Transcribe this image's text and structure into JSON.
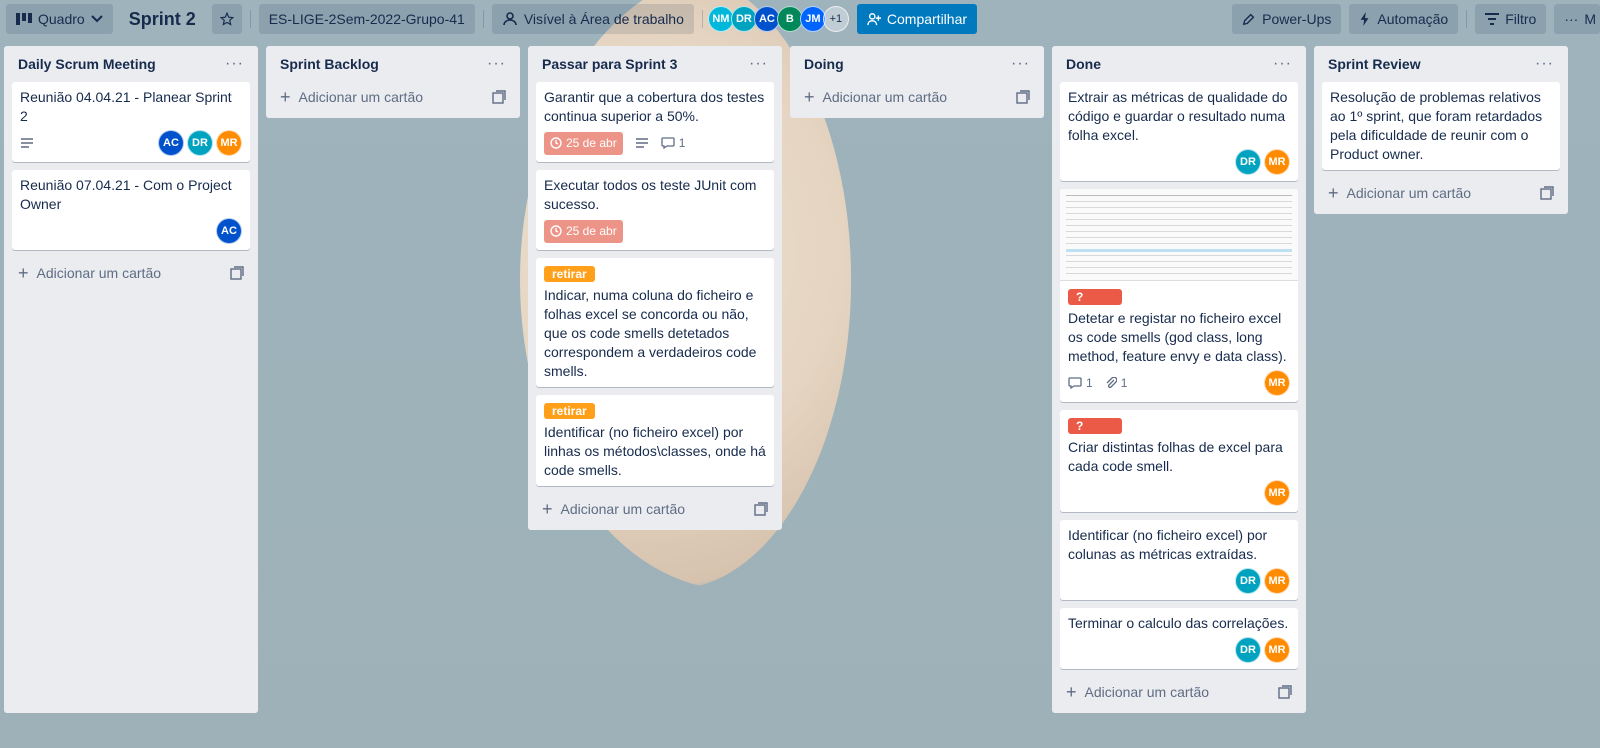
{
  "header": {
    "view_label": "Quadro",
    "board_title": "Sprint 2",
    "workspace": "ES-LIGE-2Sem-2022-Grupo-41",
    "visibility": "Visível à Área de trabalho",
    "members": [
      "NM",
      "DR",
      "AC",
      "B",
      "JM"
    ],
    "members_more": "+1",
    "share_label": "Compartilhar",
    "powerups_label": "Power-Ups",
    "automation_label": "Automação",
    "filter_label": "Filtro",
    "more_label": "M"
  },
  "add_card_label": "Adicionar um cartão",
  "lists": [
    {
      "title": "Daily Scrum Meeting",
      "cards": [
        {
          "text": "Reunião 04.04.21 - Planear Sprint 2",
          "members": [
            "AC",
            "DR",
            "MR"
          ]
        },
        {
          "text": "Reunião 07.04.21 - Com o Project Owner",
          "members": [
            "AC"
          ]
        }
      ]
    },
    {
      "title": "Sprint Backlog",
      "cards": []
    },
    {
      "title": "Passar para Sprint 3",
      "cards": [
        {
          "text": "Garantir que a cobertura dos testes continua superior a 50%.",
          "due": "25 de abr",
          "comments": "1"
        },
        {
          "text": "Executar todos os teste JUnit com sucesso.",
          "due": "25 de abr"
        },
        {
          "label": "retirar",
          "text": "Indicar, numa coluna do ficheiro e folhas excel se concorda ou não, que os code smells detetados correspondem a verdadeiros code smells."
        },
        {
          "label": "retirar",
          "text": "Identificar (no ficheiro excel) por linhas os métodos\\classes, onde há code smells."
        }
      ]
    },
    {
      "title": "Doing",
      "cards": []
    },
    {
      "title": "Done",
      "cards": [
        {
          "text": "Extrair as métricas de qualidade do código e guardar o resultado numa folha excel.",
          "members": [
            "DR",
            "MR"
          ]
        },
        {
          "label": "?",
          "text": "Detetar e registar no ficheiro excel os code smells (god class, long method, feature envy e data class).",
          "comments": "1",
          "attachments": "1",
          "members": [
            "MR"
          ]
        },
        {
          "label": "?",
          "text": "Criar distintas folhas de excel para cada code smell.",
          "members": [
            "MR"
          ]
        },
        {
          "text": "Identificar (no ficheiro excel) por colunas as métricas extraídas.",
          "members": [
            "DR",
            "MR"
          ]
        },
        {
          "text": "Terminar o calculo das correlações.",
          "members": [
            "DR",
            "MR"
          ]
        }
      ]
    },
    {
      "title": "Sprint Review",
      "cards": [
        {
          "text": "Resolução de problemas relativos ao 1º sprint, que foram retardados pela dificuldade de reunir com o Product owner."
        }
      ]
    }
  ],
  "colors": {
    "due": "#ec9488",
    "label_orange": "#ff9f1a",
    "label_red": "#eb5a46",
    "share": "#0079bf"
  }
}
